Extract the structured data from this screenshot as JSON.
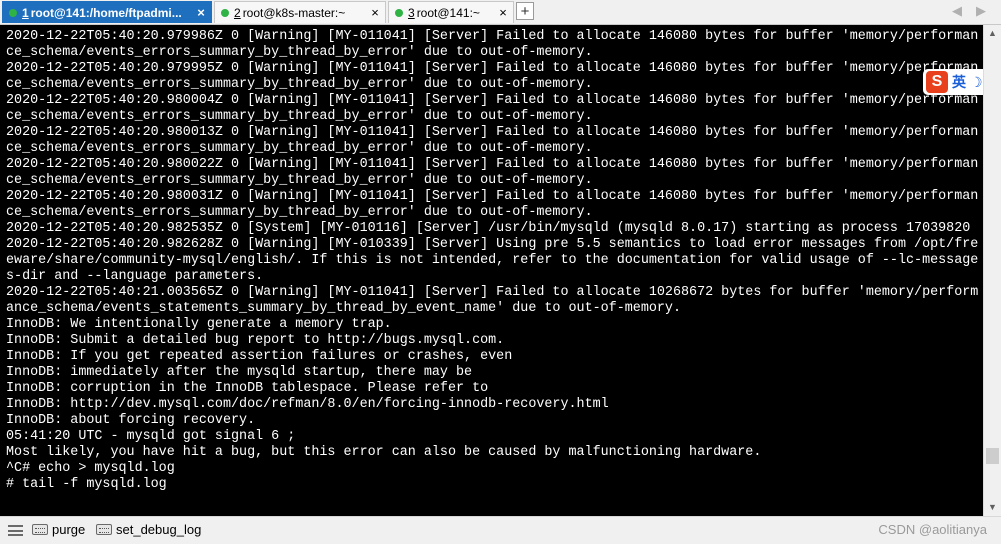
{
  "tabs": [
    {
      "num": "1",
      "label": " root@141:/home/ftpadmi...",
      "active": true
    },
    {
      "num": "2",
      "label": " root@k8s-master:~",
      "active": false
    },
    {
      "num": "3",
      "label": " root@141:~",
      "active": false
    }
  ],
  "tab_close_glyph": "×",
  "add_tab_glyph": "+",
  "nav": {
    "prev": "◀",
    "next": "▶"
  },
  "terminal_lines": [
    "2020-12-22T05:40:20.979986Z 0 [Warning] [MY-011041] [Server] Failed to allocate 146080 bytes for buffer 'memory/performan",
    "ce_schema/events_errors_summary_by_thread_by_error' due to out-of-memory.",
    "2020-12-22T05:40:20.979995Z 0 [Warning] [MY-011041] [Server] Failed to allocate 146080 bytes for buffer 'memory/performan",
    "ce_schema/events_errors_summary_by_thread_by_error' due to out-of-memory.",
    "2020-12-22T05:40:20.980004Z 0 [Warning] [MY-011041] [Server] Failed to allocate 146080 bytes for buffer 'memory/performan",
    "ce_schema/events_errors_summary_by_thread_by_error' due to out-of-memory.",
    "2020-12-22T05:40:20.980013Z 0 [Warning] [MY-011041] [Server] Failed to allocate 146080 bytes for buffer 'memory/performan",
    "ce_schema/events_errors_summary_by_thread_by_error' due to out-of-memory.",
    "2020-12-22T05:40:20.980022Z 0 [Warning] [MY-011041] [Server] Failed to allocate 146080 bytes for buffer 'memory/performan",
    "ce_schema/events_errors_summary_by_thread_by_error' due to out-of-memory.",
    "2020-12-22T05:40:20.980031Z 0 [Warning] [MY-011041] [Server] Failed to allocate 146080 bytes for buffer 'memory/performan",
    "ce_schema/events_errors_summary_by_thread_by_error' due to out-of-memory.",
    "2020-12-22T05:40:20.982535Z 0 [System] [MY-010116] [Server] /usr/bin/mysqld (mysqld 8.0.17) starting as process 17039820",
    "2020-12-22T05:40:20.982628Z 0 [Warning] [MY-010339] [Server] Using pre 5.5 semantics to load error messages from /opt/fre",
    "eware/share/community-mysql/english/. If this is not intended, refer to the documentation for valid usage of --lc-message",
    "s-dir and --language parameters.",
    "2020-12-22T05:40:21.003565Z 0 [Warning] [MY-011041] [Server] Failed to allocate 10268672 bytes for buffer 'memory/perform",
    "ance_schema/events_statements_summary_by_thread_by_event_name' due to out-of-memory.",
    "InnoDB: We intentionally generate a memory trap.",
    "InnoDB: Submit a detailed bug report to http://bugs.mysql.com.",
    "InnoDB: If you get repeated assertion failures or crashes, even",
    "InnoDB: immediately after the mysqld startup, there may be",
    "InnoDB: corruption in the InnoDB tablespace. Please refer to",
    "InnoDB: http://dev.mysql.com/doc/refman/8.0/en/forcing-innodb-recovery.html",
    "InnoDB: about forcing recovery.",
    "05:41:20 UTC - mysqld got signal 6 ;",
    "Most likely, you have hit a bug, but this error can also be caused by malfunctioning hardware.",
    "^C# echo > mysqld.log",
    "# tail -f mysqld.log"
  ],
  "scrollbar": {
    "up": "▲",
    "down": "▼"
  },
  "statusbar": {
    "items": [
      {
        "label": "purge"
      },
      {
        "label": "set_debug_log"
      }
    ],
    "watermark": "CSDN @aolitianya"
  },
  "ime": {
    "logo": "S",
    "mode": "英",
    "extra": "☽"
  }
}
